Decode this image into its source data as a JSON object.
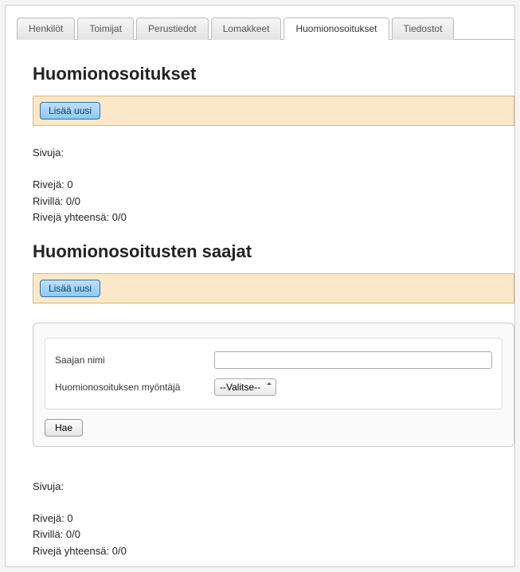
{
  "tabs": [
    {
      "label": "Henkilöt"
    },
    {
      "label": "Toimijat"
    },
    {
      "label": "Perustiedot"
    },
    {
      "label": "Lomakkeet"
    },
    {
      "label": "Huomionosoitukset"
    },
    {
      "label": "Tiedostot"
    }
  ],
  "section1": {
    "heading": "Huomionosoitukset",
    "add_label": "Lisää uusi",
    "stats": {
      "pages_label": "Sivuja:",
      "rows_label": "Rivejä: 0",
      "onrow_label": "Rivillä: 0/0",
      "total_label": "Rivejä yhteensä: 0/0"
    }
  },
  "section2": {
    "heading": "Huomionosoitusten saajat",
    "add_label": "Lisää uusi",
    "form": {
      "name_label": "Saajan nimi",
      "grantor_label": "Huomionosoituksen myöntäjä",
      "select_placeholder": "--Valitse--",
      "search_label": "Hae"
    },
    "stats": {
      "pages_label": "Sivuja:",
      "rows_label": "Rivejä: 0",
      "onrow_label": "Rivillä: 0/0",
      "total_label": "Rivejä yhteensä: 0/0"
    }
  }
}
